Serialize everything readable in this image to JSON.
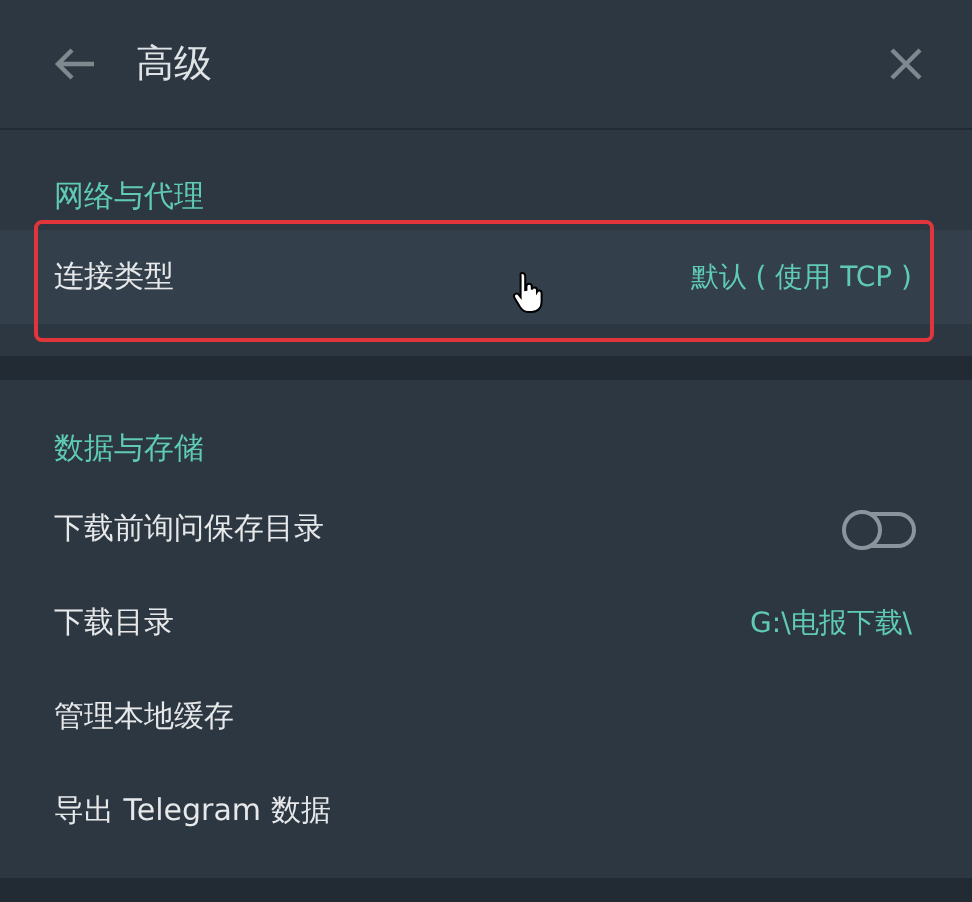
{
  "header": {
    "title": "高级"
  },
  "sections": [
    {
      "title": "网络与代理",
      "rows": [
        {
          "kind": "value",
          "label": "连接类型",
          "value": "默认 ( 使用 TCP )",
          "highlighted": true
        }
      ]
    },
    {
      "title": "数据与存储",
      "rows": [
        {
          "kind": "toggle",
          "label": "下载前询问保存目录",
          "on": false,
          "highlighted": false
        },
        {
          "kind": "value",
          "label": "下载目录",
          "value": "G:\\电报下载\\",
          "highlighted": false
        },
        {
          "kind": "plain",
          "label": "管理本地缓存",
          "highlighted": false
        },
        {
          "kind": "plain",
          "label": "导出 Telegram 数据",
          "highlighted": false
        }
      ]
    }
  ]
}
